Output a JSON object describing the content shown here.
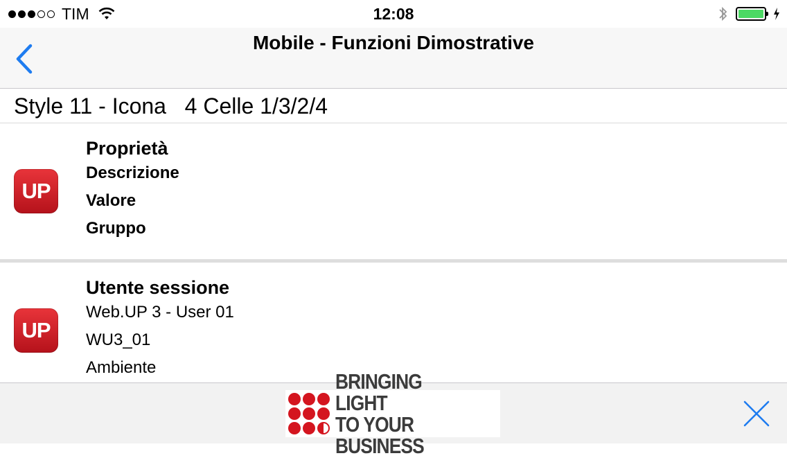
{
  "status_bar": {
    "carrier": "TIM",
    "time": "12:08",
    "signal_bars_filled": 3,
    "signal_bars_total": 5,
    "battery_level": 1.0,
    "battery_color": "#4cd964"
  },
  "navbar": {
    "title": "Mobile - Funzioni Dimostrative",
    "back_icon": "chevron-left-icon",
    "accent": "#1e7cf0"
  },
  "section": {
    "title": "Style 11 - Icona   4 Celle 1/3/2/4"
  },
  "cells": [
    {
      "icon_text": "UP",
      "title": "Proprietà",
      "lines": [
        "Descrizione",
        "Valore",
        "Gruppo"
      ]
    },
    {
      "icon_text": "UP",
      "title": "Utente sessione",
      "lines": [
        "Web.UP 3 - User 01",
        "WU3_01",
        "Ambiente"
      ]
    }
  ],
  "banner": {
    "ad_line1": "BRINGING LIGHT",
    "ad_line2": "TO YOUR BUSINESS",
    "close_icon": "close-icon",
    "brand_color": "#d4151f"
  }
}
